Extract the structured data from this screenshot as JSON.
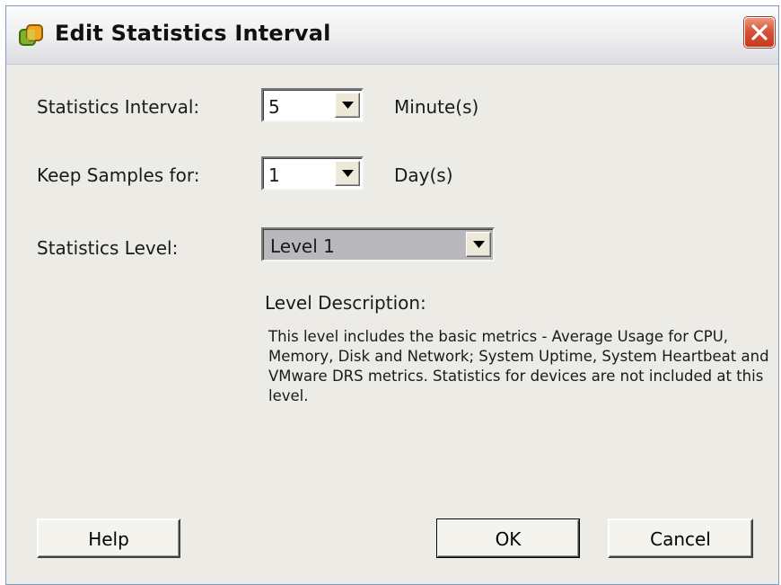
{
  "window": {
    "title": "Edit Statistics Interval",
    "icon": "vmware-vsphere-icon",
    "close_icon": "close-icon"
  },
  "form": {
    "interval": {
      "label": "Statistics Interval:",
      "value": "5",
      "unit": "Minute(s)"
    },
    "keep_samples": {
      "label": "Keep Samples for:",
      "value": "1",
      "unit": "Day(s)"
    },
    "level": {
      "label": "Statistics Level:",
      "value": "Level 1"
    }
  },
  "description": {
    "heading": "Level Description:",
    "text": "This level includes the basic metrics - Average Usage for CPU, Memory, Disk and Network; System Uptime, System Heartbeat and VMware DRS metrics. Statistics for devices are not included at this level."
  },
  "buttons": {
    "help": "Help",
    "ok": "OK",
    "cancel": "Cancel"
  },
  "colors": {
    "dialog_background": "#ecebe6",
    "close_button": "#d7543a",
    "selected_combo": "#b8b8bd"
  }
}
